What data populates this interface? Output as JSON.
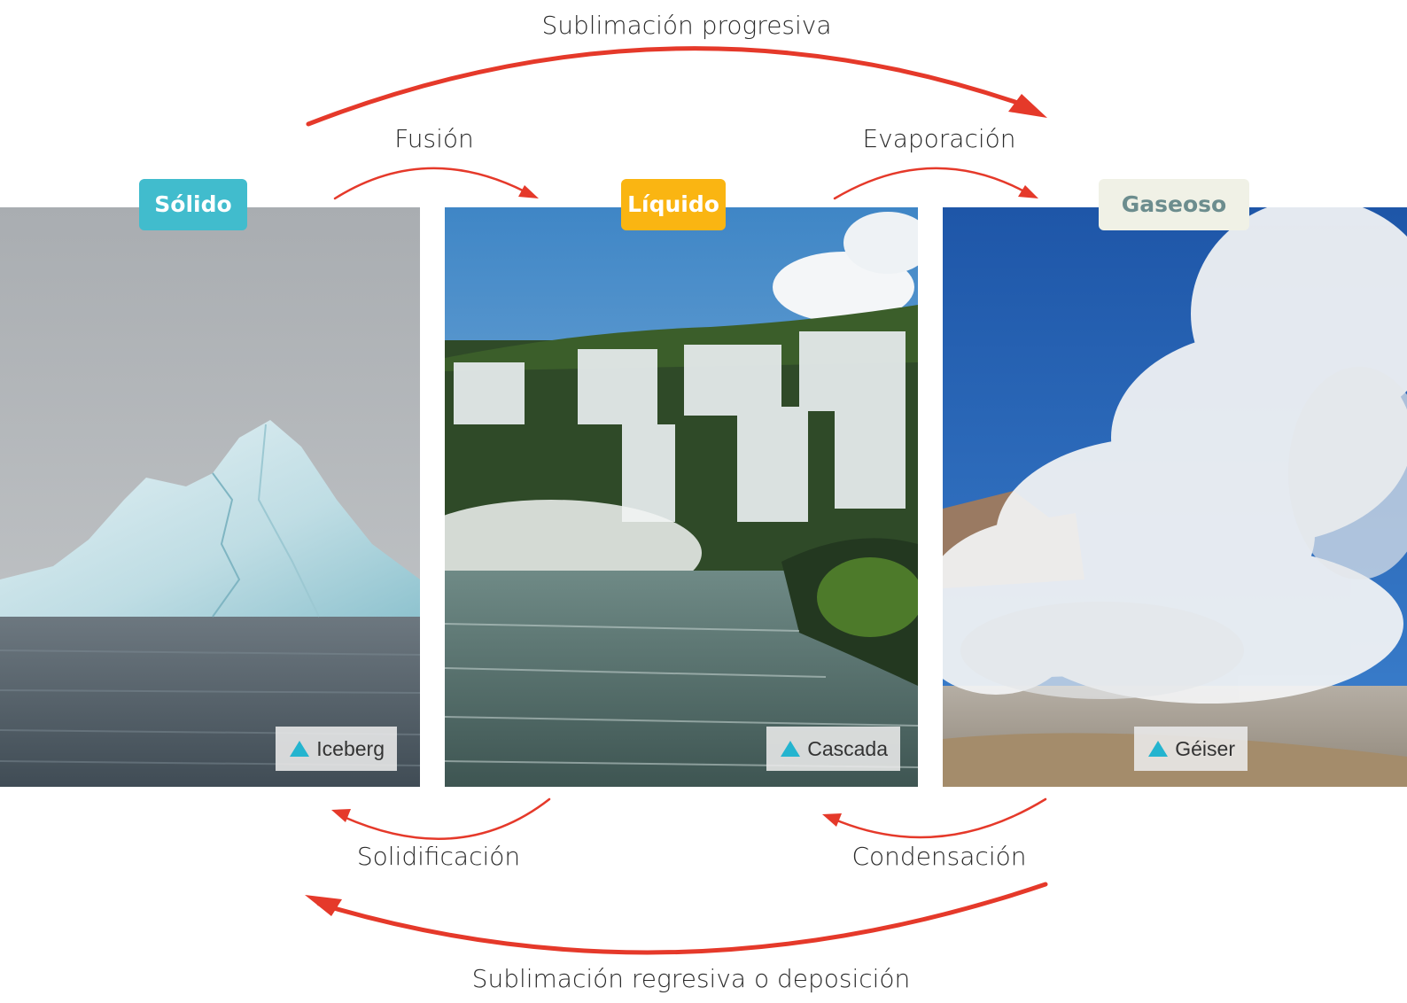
{
  "transitions": {
    "sublimacion_progresiva": "Sublimación progresiva",
    "fusion": "Fusión",
    "evaporacion": "Evaporación",
    "solidificacion": "Solidificación",
    "condensacion": "Condensación",
    "sublimacion_regresiva": "Sublimación regresiva o deposición"
  },
  "states": [
    {
      "label": "Sólido",
      "badge_color": "#41bccd",
      "text_color": "#ffffff",
      "caption": "Iceberg",
      "photo": "iceberg"
    },
    {
      "label": "Líquido",
      "badge_color": "#fab512",
      "text_color": "#ffffff",
      "caption": "Cascada",
      "photo": "waterfall"
    },
    {
      "label": "Gaseoso",
      "badge_color": "#f0f1e6",
      "text_color": "#6c8d8e",
      "caption": "Géiser",
      "photo": "geyser"
    }
  ],
  "colors": {
    "arrow": "#e5392a",
    "caption_marker": "#24b4cf"
  }
}
